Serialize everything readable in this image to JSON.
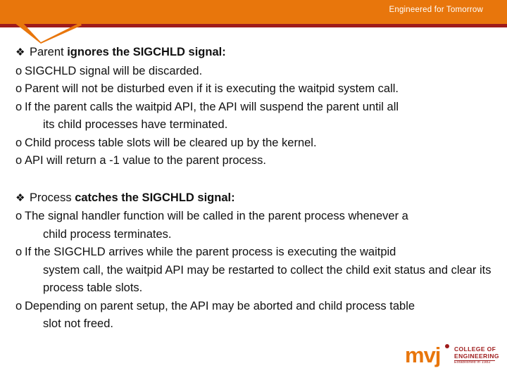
{
  "header": {
    "tagline": "Engineered for Tomorrow",
    "band_color": "#e8760c",
    "rule_color": "#9e1b1b"
  },
  "slide": {
    "blocks": [
      {
        "bullet": "❖",
        "heading_plain": "Parent ",
        "heading_bold": "ignores the SIGCHLD signal:",
        "items": [
          {
            "marker": "o",
            "text": "SIGCHLD signal will be discarded.",
            "cont": ""
          },
          {
            "marker": "o",
            "text": "Parent will not be disturbed even if it is executing the waitpid system call.",
            "cont": ""
          },
          {
            "marker": "o",
            "text": "If the parent calls the waitpid API, the API will suspend the parent until all",
            "cont": "its child processes have terminated."
          },
          {
            "marker": "o",
            "text": "Child process table slots will be cleared up by the kernel.",
            "cont": ""
          },
          {
            "marker": "o",
            "text": "API will return a -1 value to the parent process.",
            "cont": ""
          }
        ]
      },
      {
        "bullet": "❖",
        "heading_plain": "Process ",
        "heading_bold": "catches the SIGCHLD signal:",
        "items": [
          {
            "marker": "o",
            "text": "The signal handler function will be called in the parent process whenever a",
            "cont": "child process terminates."
          },
          {
            "marker": "o",
            "text": "If the SIGCHLD arrives while the parent process is executing the waitpid",
            "cont": "system call, the waitpid API may be restarted to collect the child exit status and clear its process table slots."
          },
          {
            "marker": "o",
            "text": "Depending on parent setup, the API may be aborted and child process table",
            "cont": "slot not freed."
          }
        ]
      }
    ]
  },
  "logo": {
    "wordmark": "mvj",
    "line1": "COLLEGE OF",
    "line2": "ENGINEERING",
    "line3": "Established in 1982",
    "accent": "#e8760c",
    "secondary": "#9e1b1b"
  }
}
